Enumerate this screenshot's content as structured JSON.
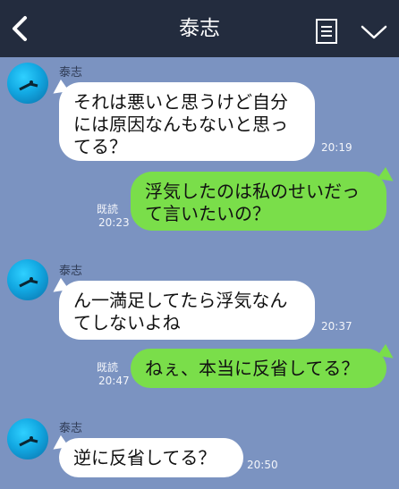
{
  "header": {
    "title": "泰志",
    "bg_color": "#232c3e"
  },
  "colors": {
    "chat_bg": "#7b93c1",
    "incoming_bubble": "#ffffff",
    "outgoing_bubble": "#7ade4a"
  },
  "messages": [
    {
      "sender": "泰志",
      "side": "left",
      "text": "それは悪いと思うけど自分\nには原因なんもないと思っ\nてる？",
      "time": "20:19"
    },
    {
      "side": "right",
      "text": "浮気したのは私のせいだっ\nて言いたいの？",
      "read": "既読",
      "time": "20:23"
    },
    {
      "sender": "泰志",
      "side": "left",
      "text": "ん一満足してたら浮気なん\nてしないよね",
      "time": "20:37"
    },
    {
      "side": "right",
      "text": "ねぇ、本当に反省してる？",
      "read": "既読",
      "time": "20:47"
    },
    {
      "sender": "泰志",
      "side": "left",
      "text": "逆に反省してる？",
      "time": "20:50"
    }
  ]
}
